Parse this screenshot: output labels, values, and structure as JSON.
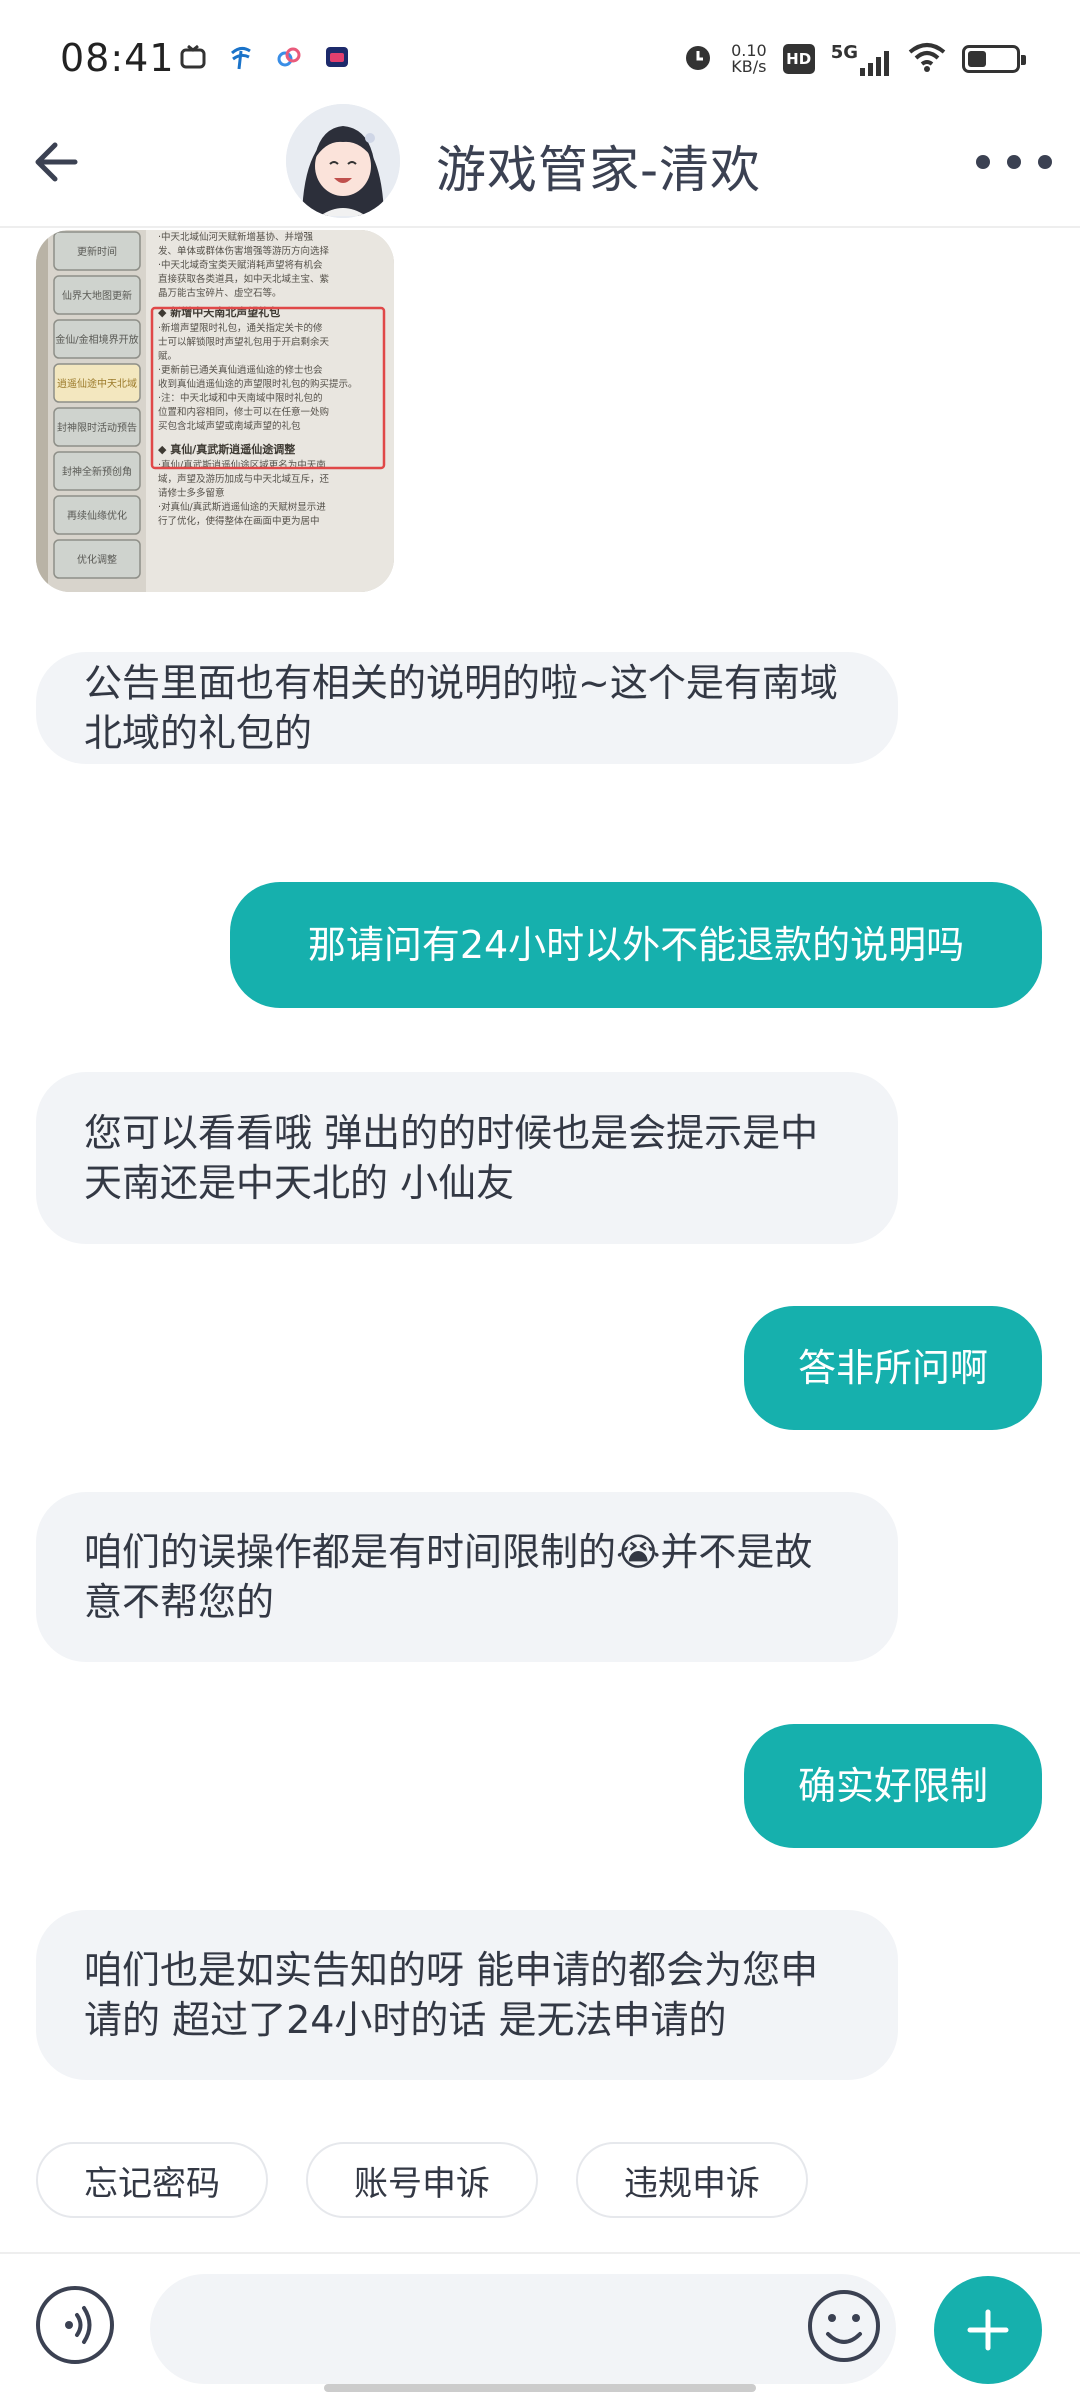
{
  "status_bar": {
    "time": "08:41",
    "net_speed_value": "0.10",
    "net_speed_unit": "KB/s",
    "hd_label": "HD",
    "network_label": "5G",
    "battery_level": 0.4
  },
  "header": {
    "title": "游戏管家-清欢",
    "icons": {
      "back": "arrow-left-icon",
      "more": "more-icon"
    }
  },
  "image_message": {
    "menu_items": [
      "更新时间",
      "仙界大地图更新",
      "金仙/金相境界开放",
      "逍遥仙途中天北域",
      "封神限时活动预告",
      "封神全新预创角",
      "再续仙缘优化",
      "优化调整"
    ],
    "header_line": "·中天北域仙河天赋新增基协、并增强",
    "lines_top": [
      "发、单体或群体伤害增强等游历方向选择",
      "·中天北域奇宝类天赋消耗声望将有机会",
      "直接获取各类道具，如中天北域主宝、紫",
      "晶万能古宝碎片、虚空石等。"
    ],
    "highlight_title": "◆ 新增中天南北声望礼包",
    "highlight_lines": [
      "·新增声望限时礼包，通关指定关卡的修",
      "士可以解锁限时声望礼包用于开启剩余天",
      "赋。",
      "·更新前已通关真仙逍遥仙途的修士也会",
      "收到真仙逍遥仙途的声望限时礼包的购买提示。",
      "·注：中天北域和中天南域中限时礼包的",
      "位置和内容相同，修士可以在任意一处购",
      "买包含北域声望或南域声望的礼包"
    ],
    "bottom_title": "◆ 真仙/真武斯逍遥仙途调整",
    "bottom_lines": [
      "·真仙/真武斯逍遥仙途区域更名为中天南",
      "域，声望及游历加成与中天北域互斥，还",
      "请修士多多留意",
      "·对真仙/真武斯逍遥仙途的天赋树显示进",
      "行了优化，使得整体在画面中更为居中"
    ]
  },
  "messages": [
    {
      "side": "in",
      "text": "公告里面也有相关的说明的啦~这个是有南域北域的礼包的"
    },
    {
      "side": "out",
      "text": "那请问有24小时以外不能退款的说明吗"
    },
    {
      "side": "in",
      "text": "您可以看看哦 弹出的的时候也是会提示是中天南还是中天北的 小仙友"
    },
    {
      "side": "out",
      "text": "答非所问啊"
    },
    {
      "side": "in",
      "text": "咱们的误操作都是有时间限制的😭并不是故意不帮您的"
    },
    {
      "side": "out",
      "text": "确实好限制"
    },
    {
      "side": "in",
      "text": "咱们也是如实告知的呀 能申请的都会为您申请的 超过了24小时的话 是无法申请的"
    }
  ],
  "quick_replies": [
    "忘记密码",
    "账号申诉",
    "违规申诉"
  ],
  "input_bar": {
    "placeholder": "",
    "icons": {
      "voice": "voice-icon",
      "emoji": "emoji-icon",
      "plus": "plus-icon"
    }
  },
  "colors": {
    "accent": "#16b0ad",
    "incoming_bubble": "#f2f4f7",
    "header_text": "#3b4152"
  }
}
